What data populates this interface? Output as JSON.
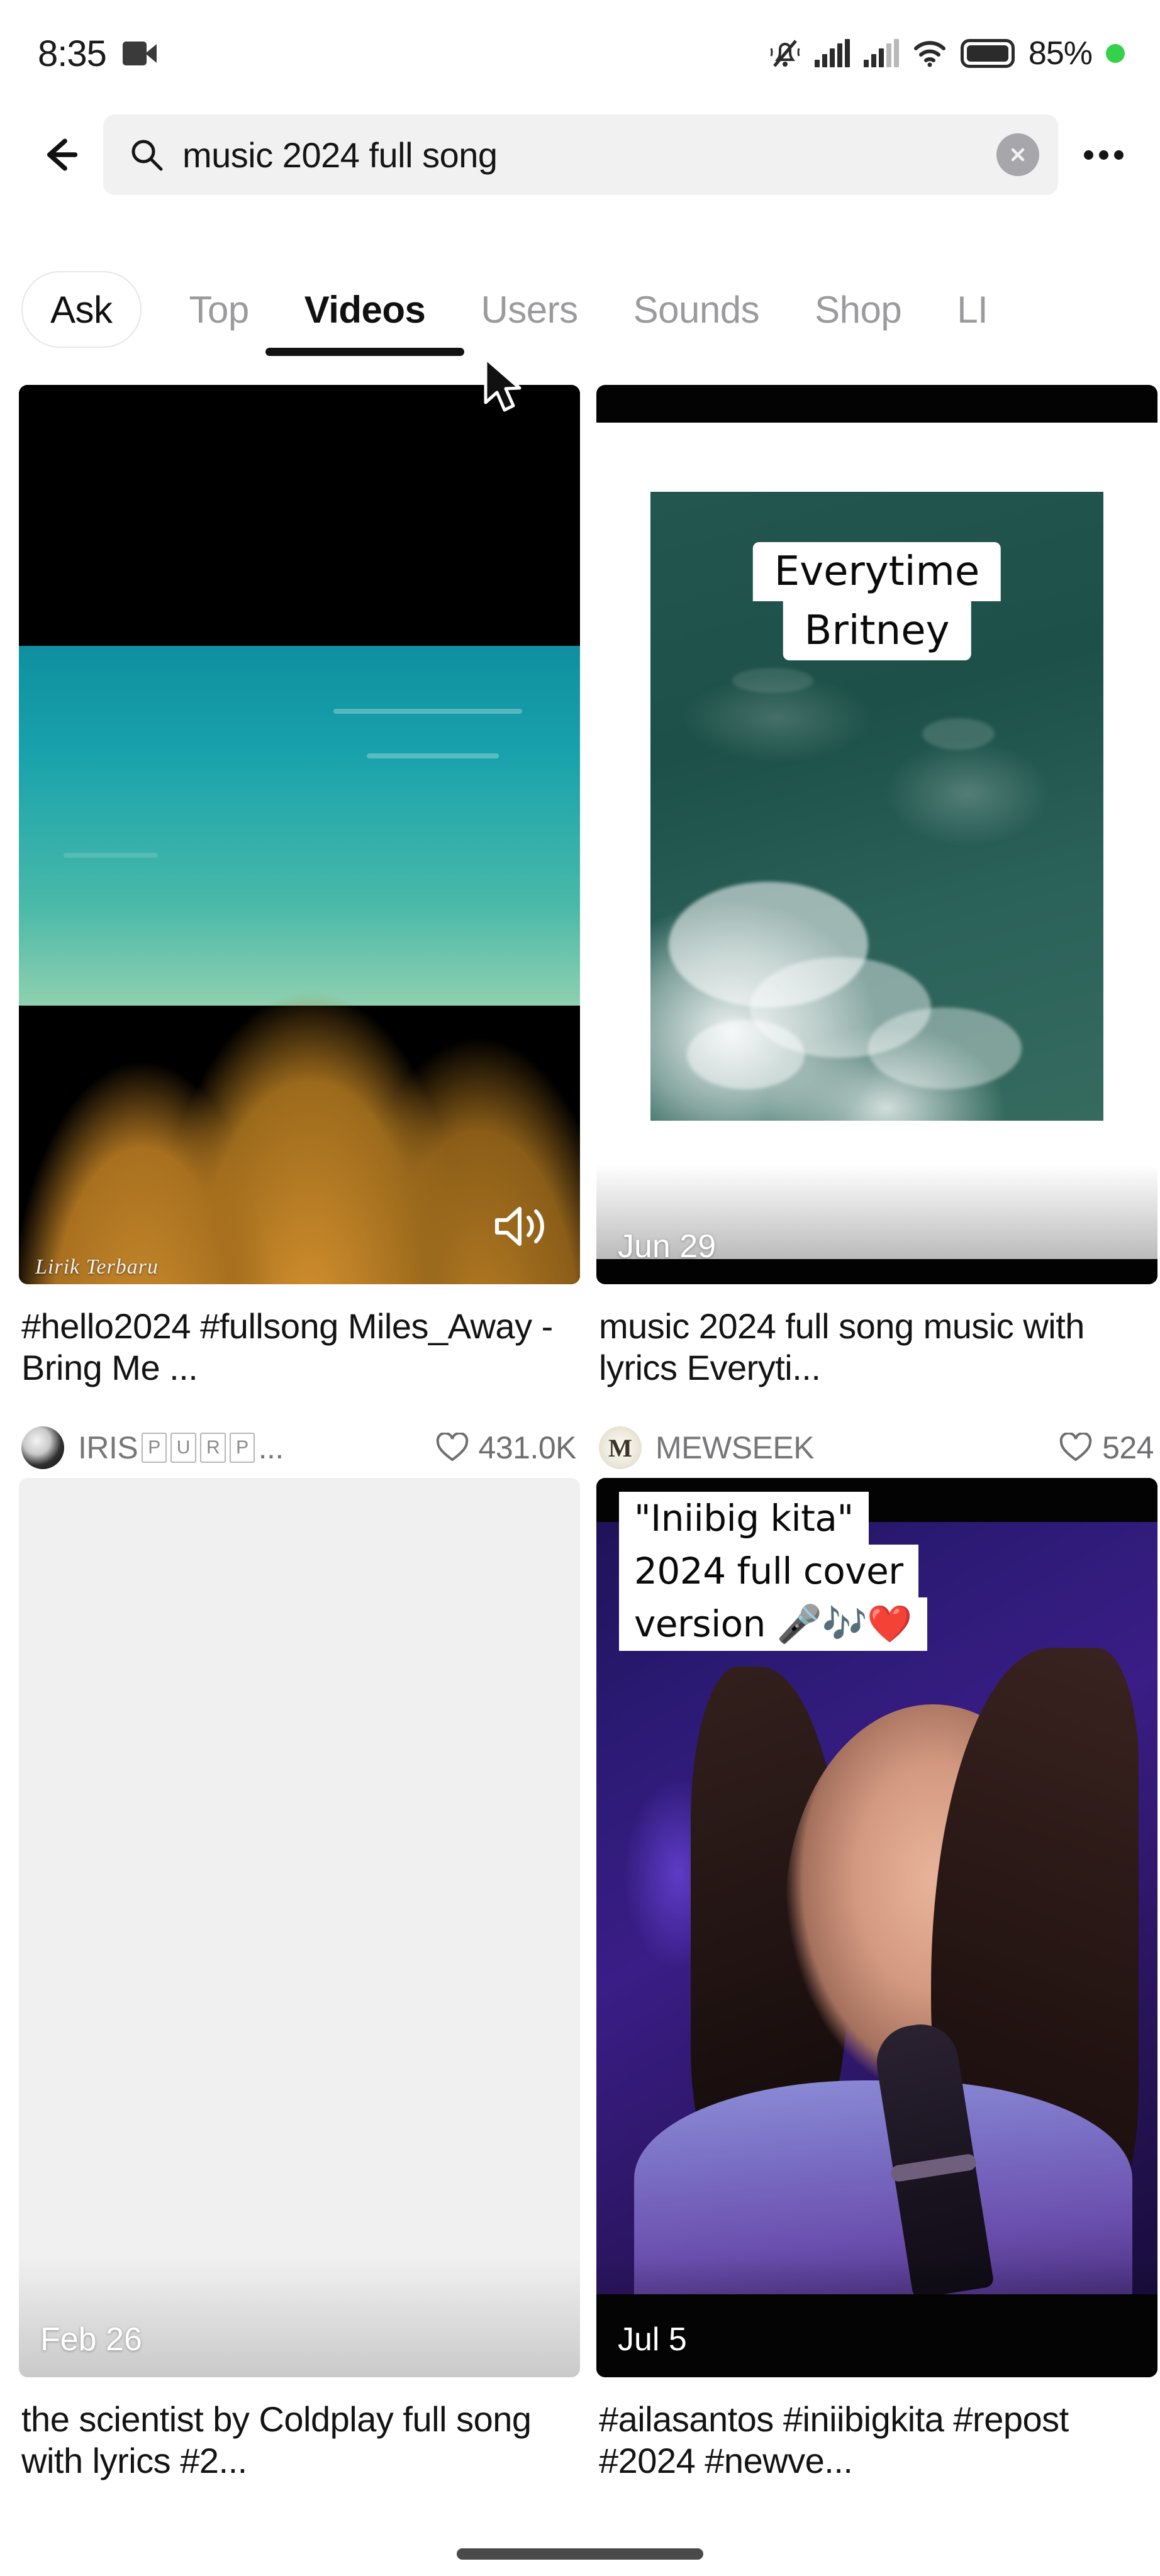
{
  "status_bar": {
    "clock": "8:35",
    "battery_percent": "85%",
    "icons": [
      "camcorder-icon",
      "bell-mute-icon",
      "signal-bars-icon",
      "signal-bars-secondary-icon",
      "wifi-icon",
      "battery-icon",
      "green-dot-icon"
    ]
  },
  "header": {
    "back_icon": "arrow-left-icon",
    "search_icon": "search-icon",
    "search_value": "music 2024 full song",
    "search_placeholder": "Search",
    "clear_icon": "close-circle-icon",
    "more_icon": "more-horizontal-icon"
  },
  "tabs": [
    {
      "label": "Ask",
      "style": "pill",
      "active": false
    },
    {
      "label": "Top",
      "style": "plain",
      "active": false
    },
    {
      "label": "Videos",
      "style": "plain",
      "active": true
    },
    {
      "label": "Users",
      "style": "plain",
      "active": false
    },
    {
      "label": "Sounds",
      "style": "plain",
      "active": false
    },
    {
      "label": "Shop",
      "style": "plain",
      "active": false
    },
    {
      "label": "LI",
      "style": "plain",
      "active": false
    }
  ],
  "results": [
    {
      "caption": "#hello2024 #fullsong Miles_Away - Bring Me ...",
      "author": "IRIS",
      "author_tofu": [
        "P",
        "U",
        "R",
        "P"
      ],
      "author_ellipsis": "...",
      "likes": "431.0K",
      "date": "",
      "overlay_lines": [],
      "watermark": "Lirik Terbaru",
      "sound_icon": "volume-on-icon"
    },
    {
      "caption": "music 2024 full song music with lyrics Everyti...",
      "author": "MEWSEEK",
      "author_tofu": [],
      "author_ellipsis": "",
      "likes": "524",
      "date": "Jun 29",
      "overlay_lines": [
        "Everytime",
        "Britney"
      ],
      "watermark": "",
      "sound_icon": ""
    },
    {
      "caption": "the scientist by Coldplay full song with lyrics #2...",
      "author": "",
      "author_tofu": [],
      "author_ellipsis": "",
      "likes": "",
      "date": "Feb 26",
      "overlay_lines": [],
      "watermark": "",
      "sound_icon": ""
    },
    {
      "caption": "#ailasantos #iniibigkita #repost #2024 #newve...",
      "author": "",
      "author_tofu": [],
      "author_ellipsis": "",
      "likes": "",
      "date": "Jul 5",
      "overlay_lines": [
        "\"Iniibig kita\"",
        "2024 full cover",
        "version 🎤🎶❤️"
      ],
      "watermark": "",
      "sound_icon": ""
    }
  ],
  "colors": {
    "accent_dark": "#121212",
    "muted_text": "#9b9b9e",
    "search_bg": "#f1f1f2",
    "battery_green": "#35d14a"
  }
}
